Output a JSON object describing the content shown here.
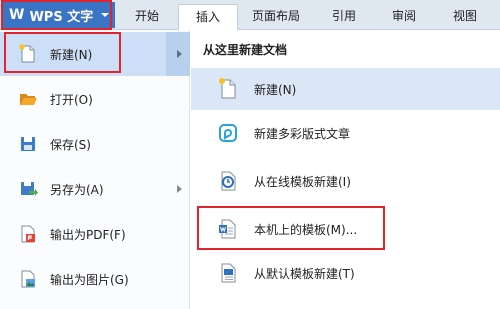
{
  "app": {
    "logo_text": "W",
    "menu_title": "WPS 文字"
  },
  "ribbon": {
    "tabs": [
      {
        "label": "开始"
      },
      {
        "label": "插入"
      },
      {
        "label": "页面布局"
      },
      {
        "label": "引用"
      },
      {
        "label": "审阅"
      },
      {
        "label": "视图"
      }
    ],
    "active_tab": "插入"
  },
  "file_menu": {
    "items": [
      {
        "label": "新建(N)",
        "icon": "new-document-icon",
        "has_submenu": true,
        "selected": true
      },
      {
        "label": "打开(O)",
        "icon": "open-folder-icon",
        "has_submenu": false
      },
      {
        "label": "保存(S)",
        "icon": "save-disk-icon",
        "has_submenu": false
      },
      {
        "label": "另存为(A)",
        "icon": "save-as-icon",
        "has_submenu": true
      },
      {
        "label": "输出为PDF(F)",
        "icon": "export-pdf-icon",
        "has_submenu": false
      },
      {
        "label": "输出为图片(G)",
        "icon": "export-image-icon",
        "has_submenu": false
      }
    ]
  },
  "new_submenu": {
    "title": "从这里新建文档",
    "items": [
      {
        "label": "新建(N)",
        "icon": "new-document-icon",
        "selected": true
      },
      {
        "label": "新建多彩版式文章",
        "icon": "colorful-article-icon"
      },
      {
        "label": "从在线模板新建(I)",
        "icon": "online-template-icon"
      },
      {
        "label": "本机上的模板(M)...",
        "icon": "local-template-icon"
      },
      {
        "label": "从默认模板新建(T)",
        "icon": "default-template-icon"
      }
    ]
  },
  "colors": {
    "accent": "#3b73c5",
    "highlight_red": "#e0242c",
    "selected_bg": "#cddff7",
    "tabbar_bg": "#dfe7f1"
  }
}
